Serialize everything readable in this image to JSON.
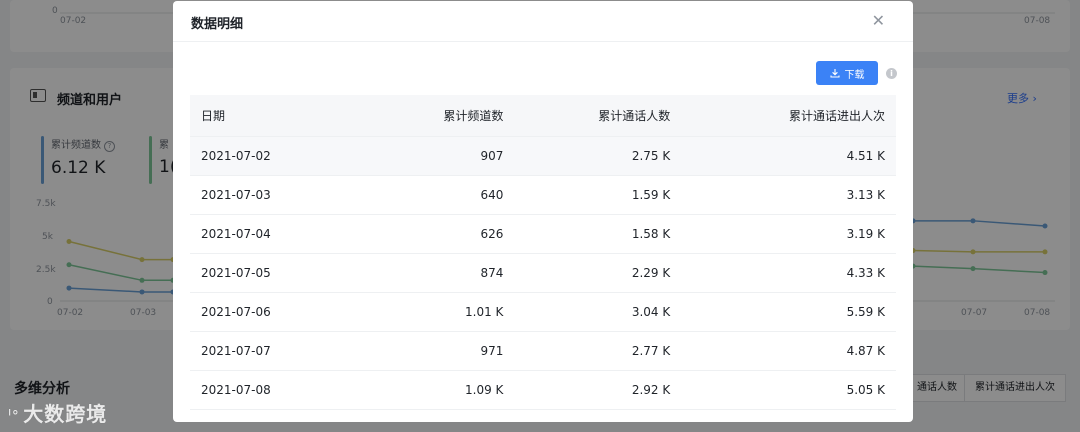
{
  "background": {
    "top_ticks": [
      "0",
      "07-02",
      "07-08"
    ],
    "section_title": "频道和用户",
    "more_label": "更多",
    "metric1": {
      "label": "累计频道数",
      "value": "6.12 K",
      "help": "?"
    },
    "metric2": {
      "label": "累",
      "value": "1("
    },
    "y_ticks": [
      "7.5k",
      "5k",
      "2.5k",
      "0"
    ],
    "x_ticks_left": [
      "07-02",
      "07-03"
    ],
    "x_ticks_right": [
      "07-07",
      "07-08"
    ],
    "bottom_title": "多维分析",
    "pill_buttons": [
      "通话人数",
      "累计通话进出人次"
    ],
    "watermark": "大数跨境",
    "colors": {
      "blue": "#6aa1d8",
      "green": "#7fc89a",
      "yellow": "#d9cf6b"
    },
    "series_left": {
      "yellow": [
        4.6,
        3.2,
        3.2
      ],
      "green": [
        2.8,
        1.6,
        1.6
      ],
      "blue": [
        1.0,
        0.7,
        0.7
      ]
    },
    "series_right": {
      "blue": [
        6.2,
        6.2,
        5.8
      ],
      "yellow": [
        3.9,
        3.8,
        3.8
      ],
      "green": [
        2.7,
        2.5,
        2.2
      ]
    }
  },
  "modal": {
    "title": "数据明细",
    "close_icon": "close-icon",
    "download_label": "下载",
    "info": "i",
    "table": {
      "headers": [
        "日期",
        "累计频道数",
        "累计通话人数",
        "累计通话进出人次"
      ],
      "rows": [
        [
          "2021-07-02",
          "907",
          "2.75 K",
          "4.51 K"
        ],
        [
          "2021-07-03",
          "640",
          "1.59 K",
          "3.13 K"
        ],
        [
          "2021-07-04",
          "626",
          "1.58 K",
          "3.19 K"
        ],
        [
          "2021-07-05",
          "874",
          "2.29 K",
          "4.33 K"
        ],
        [
          "2021-07-06",
          "1.01 K",
          "3.04 K",
          "5.59 K"
        ],
        [
          "2021-07-07",
          "971",
          "2.77 K",
          "4.87 K"
        ],
        [
          "2021-07-08",
          "1.09 K",
          "2.92 K",
          "5.05 K"
        ]
      ]
    }
  }
}
